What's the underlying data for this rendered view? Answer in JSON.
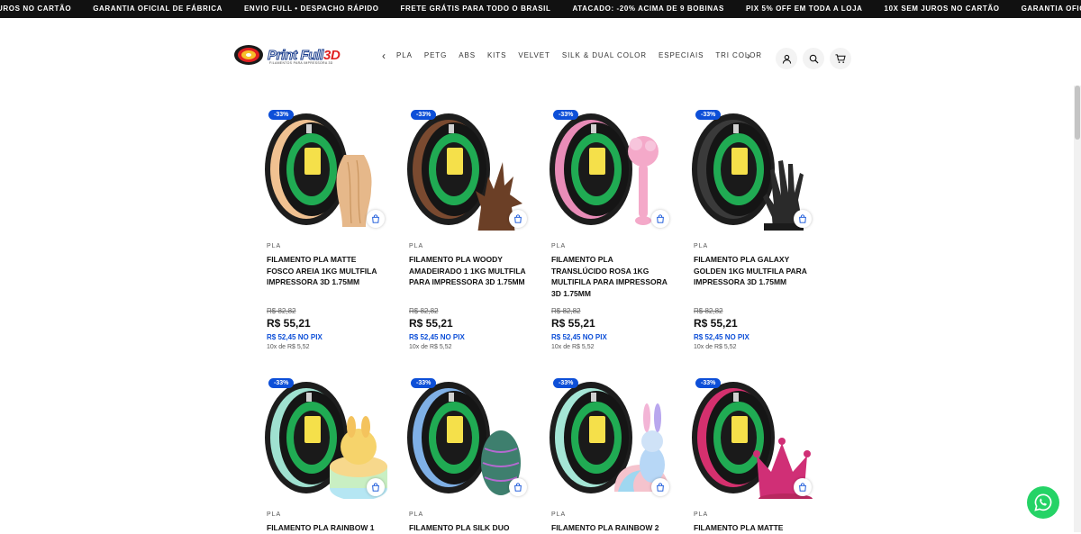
{
  "ticker": {
    "items": [
      "JUROS NO CARTÃO",
      "GARANTIA OFICIAL DE FÁBRICA",
      "ENVIO FULL • DESPACHO RÁPIDO",
      "FRETE GRÁTIS PARA TODO O BRASIL",
      "ATACADO: -20% ACIMA DE 9 BOBINAS",
      "PIX 5% OFF EM TODA A LOJA",
      "10X SEM JUROS NO CARTÃO",
      "GARANTIA OFICIAL DE FÁ"
    ]
  },
  "header": {
    "logo_text_main": "Print Full",
    "logo_text_accent": "3D",
    "logo_tagline": "FILAMENTOS PARA IMPRESSORA 3D",
    "nav": [
      "PLA",
      "PETG",
      "ABS",
      "KITS",
      "VELVET",
      "SILK & DUAL COLOR",
      "ESPECIAIS",
      "TRI COLOR"
    ],
    "prev_arrow": "‹",
    "next_arrow": "›"
  },
  "products": [
    {
      "badge": "-33%",
      "category": "PLA",
      "title": "FILAMENTO PLA MATTE FOSCO AREIA 1KG MULTFILA IMPRESSORA 3D 1.75MM",
      "old_price": "R$ 82,82",
      "price": "R$ 55,21",
      "pix": "R$ 52,45 NO PIX",
      "installments": "10x de R$ 5,52",
      "spool_color": "#f0c191",
      "object_color": "#e6b88a",
      "object": "vase"
    },
    {
      "badge": "-33%",
      "category": "PLA",
      "title": "FILAMENTO PLA WOODY AMADEIRADO 1 1KG MULTFILA PARA IMPRESSORA 3D 1.75MM",
      "old_price": "R$ 82,82",
      "price": "R$ 55,21",
      "pix": "R$ 52,45 NO PIX",
      "installments": "10x de R$ 5,52",
      "spool_color": "#7a4a30",
      "object_color": "#6b3f26",
      "object": "stump"
    },
    {
      "badge": "-33%",
      "category": "PLA",
      "title": "FILAMENTO PLA TRANSLÚCIDO ROSA 1KG MULTIFILA PARA IMPRESSORA 3D 1.75MM",
      "old_price": "R$ 82,82",
      "price": "R$ 55,21",
      "pix": "R$ 52,45 NO PIX",
      "installments": "10x de R$ 5,52",
      "spool_color": "#e98cb8",
      "object_color": "#f4a9c9",
      "object": "wand"
    },
    {
      "badge": "-33%",
      "category": "PLA",
      "title": "FILAMENTO PLA GALAXY GOLDEN 1KG MULTFILA PARA IMPRESSORA 3D 1.75MM",
      "old_price": "R$ 82,82",
      "price": "R$ 55,21",
      "pix": "R$ 52,45 NO PIX",
      "installments": "10x de R$ 5,52",
      "spool_color": "#3a3a3a",
      "object_color": "#2a2a2a",
      "object": "hand"
    },
    {
      "badge": "-33%",
      "category": "PLA",
      "title": "FILAMENTO PLA RAINBOW 1",
      "old_price": "",
      "price": "",
      "pix": "",
      "installments": "",
      "spool_color": "#9fe1d0",
      "object_color": "#f6d36b",
      "object": "cake"
    },
    {
      "badge": "-33%",
      "category": "PLA",
      "title": "FILAMENTO PLA SILK DUO",
      "old_price": "",
      "price": "",
      "pix": "",
      "installments": "",
      "spool_color": "#7fb0e6",
      "object_color": "#3e7f6e",
      "object": "egg"
    },
    {
      "badge": "-33%",
      "category": "PLA",
      "title": "FILAMENTO PLA RAINBOW 2",
      "old_price": "",
      "price": "",
      "pix": "",
      "installments": "",
      "spool_color": "#a5e6d6",
      "object_color": "#f3b5d6",
      "object": "bunny"
    },
    {
      "badge": "-33%",
      "category": "PLA",
      "title": "FILAMENTO PLA MATTE",
      "old_price": "",
      "price": "",
      "pix": "",
      "installments": "",
      "spool_color": "#d5306e",
      "object_color": "#d02f76",
      "object": "crown"
    }
  ]
}
